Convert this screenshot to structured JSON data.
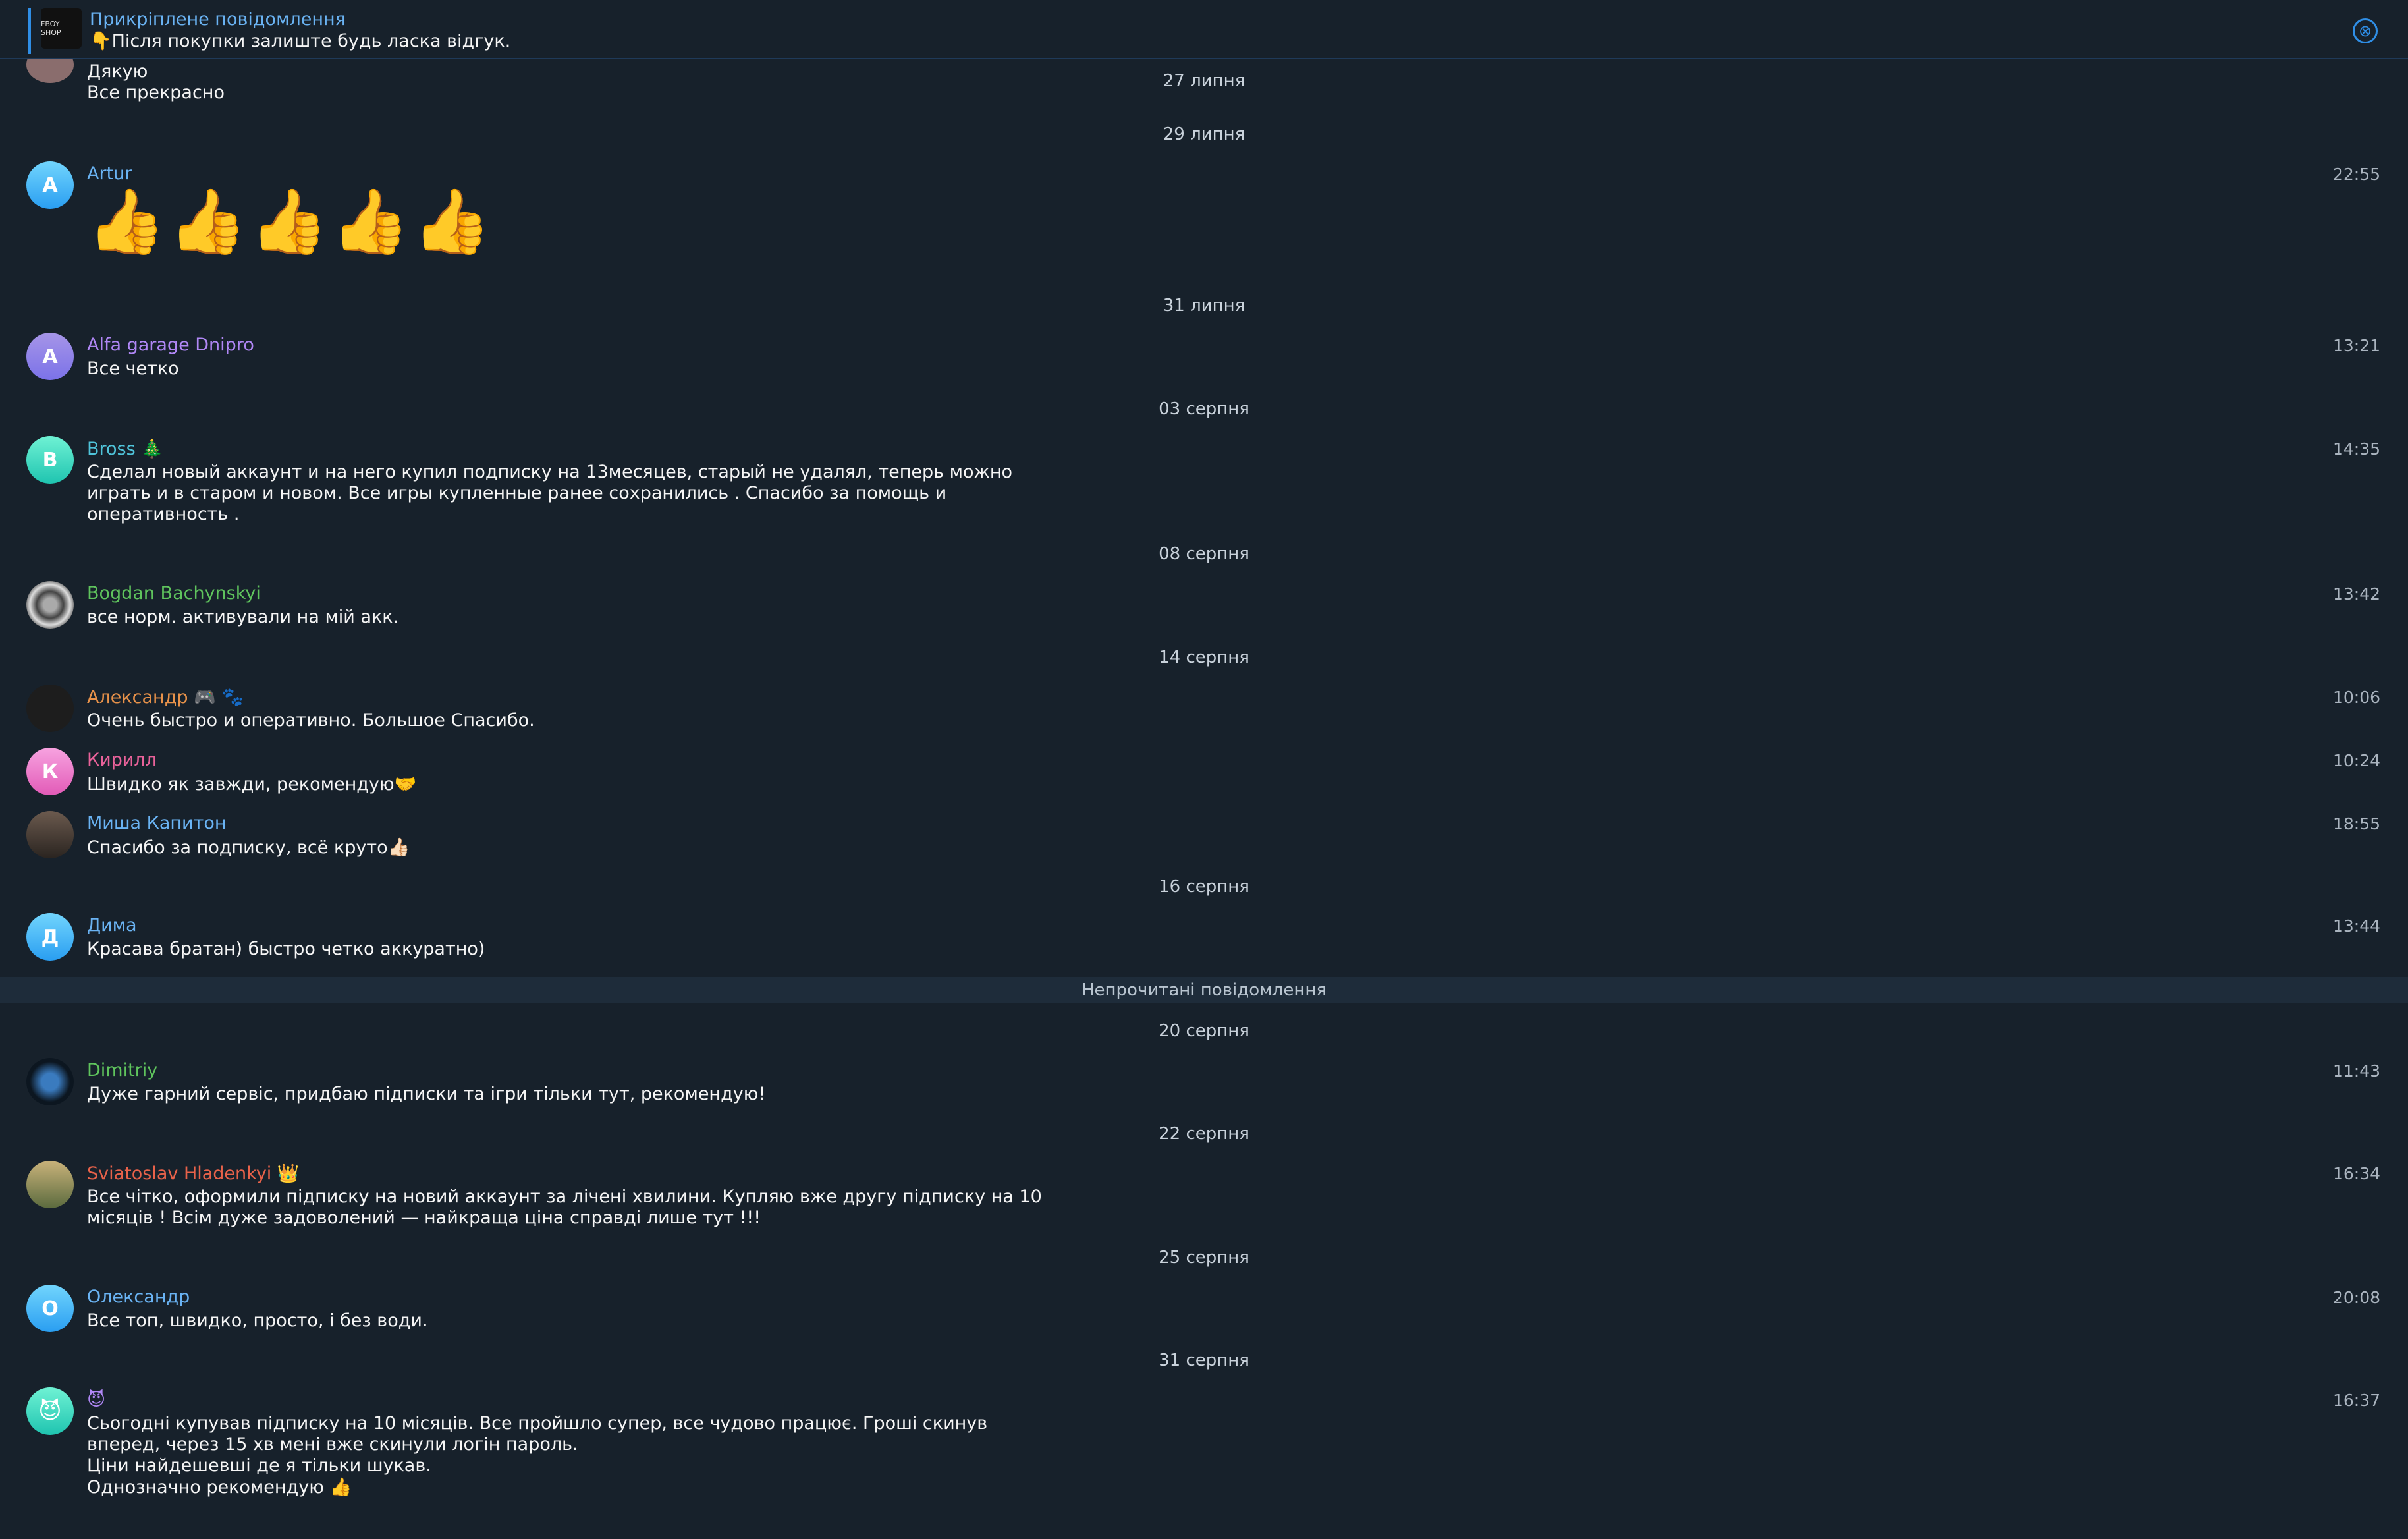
{
  "pinned": {
    "thumb_label": "FBOY SHOP",
    "title": "Прикріплене повідомлення",
    "text": "👇Після покупки залиште будь ласка відгук.",
    "close_icon": "⊗"
  },
  "dates": [
    "27 липня",
    "29 липня",
    "31 липня",
    "03 серпня",
    "08 серпня",
    "14 серпня",
    "16 серпня",
    "20 серпня",
    "22 серпня",
    "25 серпня",
    "31 серпня"
  ],
  "unread_label": "Непрочитані повідомлення",
  "messages": [
    {
      "lines": [
        "Дякую",
        "Все прекрасно"
      ]
    },
    {
      "name": "Artur",
      "initial": "A",
      "time": "22:55",
      "emoji": "👍👍👍👍👍"
    },
    {
      "name": "Alfa garage Dnipro",
      "initial": "A",
      "time": "13:21",
      "lines": [
        "Все четко"
      ]
    },
    {
      "name": "Bross 🎄",
      "initial": "B",
      "time": "14:35",
      "lines": [
        "Сделал новый аккаунт и на него купил подписку на 13месяцев, старый не удалял, теперь можно",
        "играть и в старом и новом. Все игры купленные ранее сохранились . Спасибо за помощь и",
        "оперативность ."
      ]
    },
    {
      "name": "Bogdan Bachynskyi",
      "time": "13:42",
      "lines": [
        "все норм. активували на мій акк."
      ]
    },
    {
      "name": "Александр 🎮 🐾",
      "time": "10:06",
      "lines": [
        "Очень быстро и оперативно. Большое Спасибо."
      ]
    },
    {
      "name": "Кирилл",
      "initial": "К",
      "time": "10:24",
      "lines": [
        "Швидко як завжди, рекомендую🤝"
      ]
    },
    {
      "name": "Миша Капитон",
      "time": "18:55",
      "lines": [
        "Спасибо за подписку, всё круто👍🏻"
      ]
    },
    {
      "name": "Дима",
      "initial": "Д",
      "time": "13:44",
      "lines": [
        "Красава братан) быстро четко аккуратно)"
      ]
    },
    {
      "name": "Dimitriy",
      "time": "11:43",
      "lines": [
        "Дуже гарний сервіс, придбаю підписки та ігри тільки тут, рекомендую!"
      ]
    },
    {
      "name": "Sviatoslav Hladenkyi 👑",
      "time": "16:34",
      "lines": [
        "Все чітко, оформили підписку на новий аккаунт за лічені хвилини. Купляю вже другу підписку на 10",
        "місяців ! Всім дуже задоволений — найкраща ціна справді лише тут !!!"
      ]
    },
    {
      "name": "Олександр",
      "initial": "О",
      "time": "20:08",
      "lines": [
        "Все топ, швидко, просто, і без води."
      ]
    },
    {
      "name": "😈",
      "initial": "😈",
      "time": "16:37",
      "lines": [
        "Сьогодні купував підписку на 10 місяців. Все пройшло супер, все чудово працює. Гроші скинув",
        "вперед, через 15 хв мені вже скинули логін пароль.",
        "Ціни найдешевші де я тільки шукав.",
        "Однозначно рекомендую 👍"
      ]
    }
  ]
}
